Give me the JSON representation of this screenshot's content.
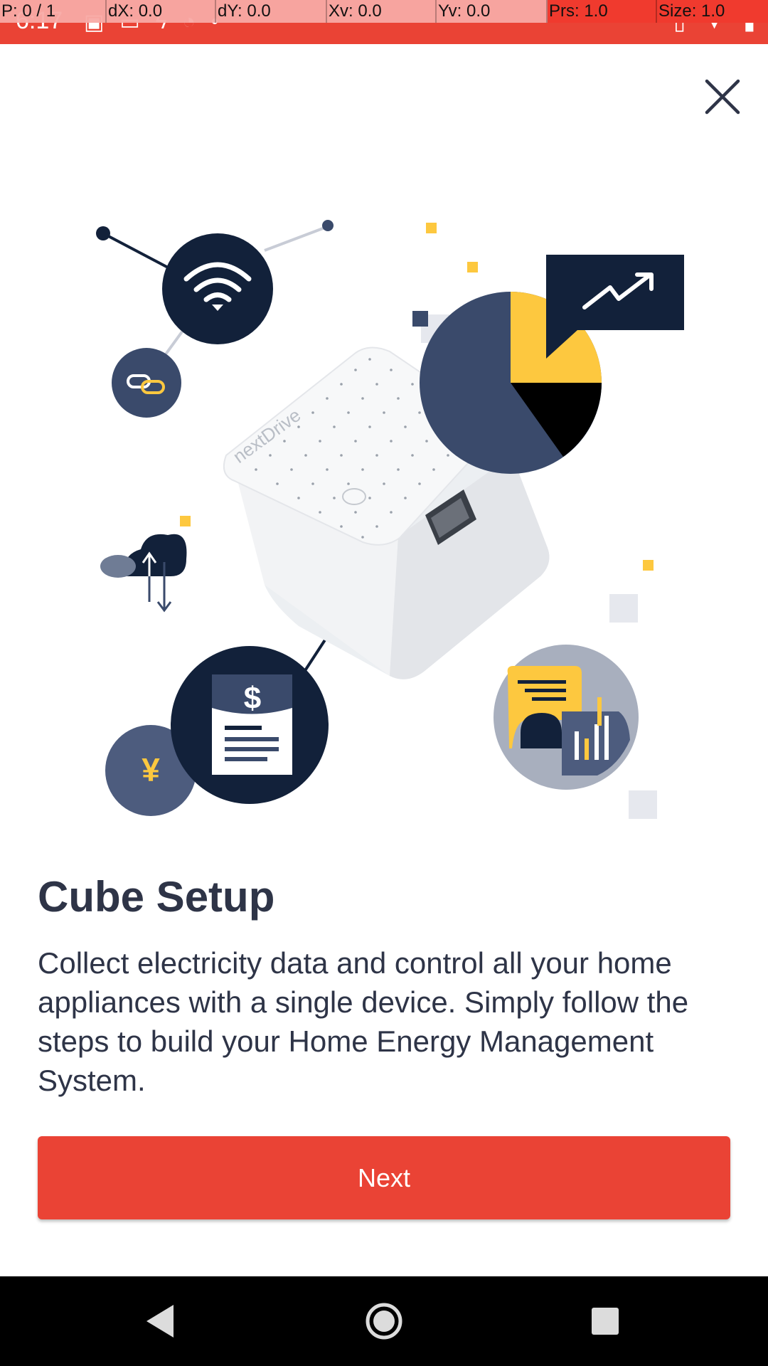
{
  "status_bar": {
    "time": "6:17",
    "left_icons": [
      "image-icon",
      "chat-icon",
      "flash-icon",
      "sync-icon",
      "dot-icon"
    ],
    "right_icons": [
      "vibrate-icon",
      "wifi-icon",
      "battery-icon"
    ]
  },
  "debug_overlay": {
    "pointer": "P: 0 / 1",
    "dx": "dX: 0.0",
    "dy": "dY: 0.0",
    "xv": "Xv: 0.0",
    "yv": "Yv: 0.0",
    "prs": "Prs: 1.0",
    "size": "Size: 1.0"
  },
  "illustration": {
    "device_brand": "nextDrive",
    "dollar_symbol": "$",
    "yen_symbol": "¥",
    "colors": {
      "navy": "#12213a",
      "slate": "#3a4a6b",
      "slate_light": "#4d5c7e",
      "yellow": "#fdc83f",
      "grey_circle": "#a8afbe",
      "light_square": "#e6e8ee"
    }
  },
  "content": {
    "title": "Cube Setup",
    "description": "Collect electricity data and control all your home appliances with a single device. Simply follow the steps to build your Home Energy Management System.",
    "next_button_label": "Next"
  },
  "colors": {
    "accent": "#ea4335",
    "text": "#2e3447"
  }
}
